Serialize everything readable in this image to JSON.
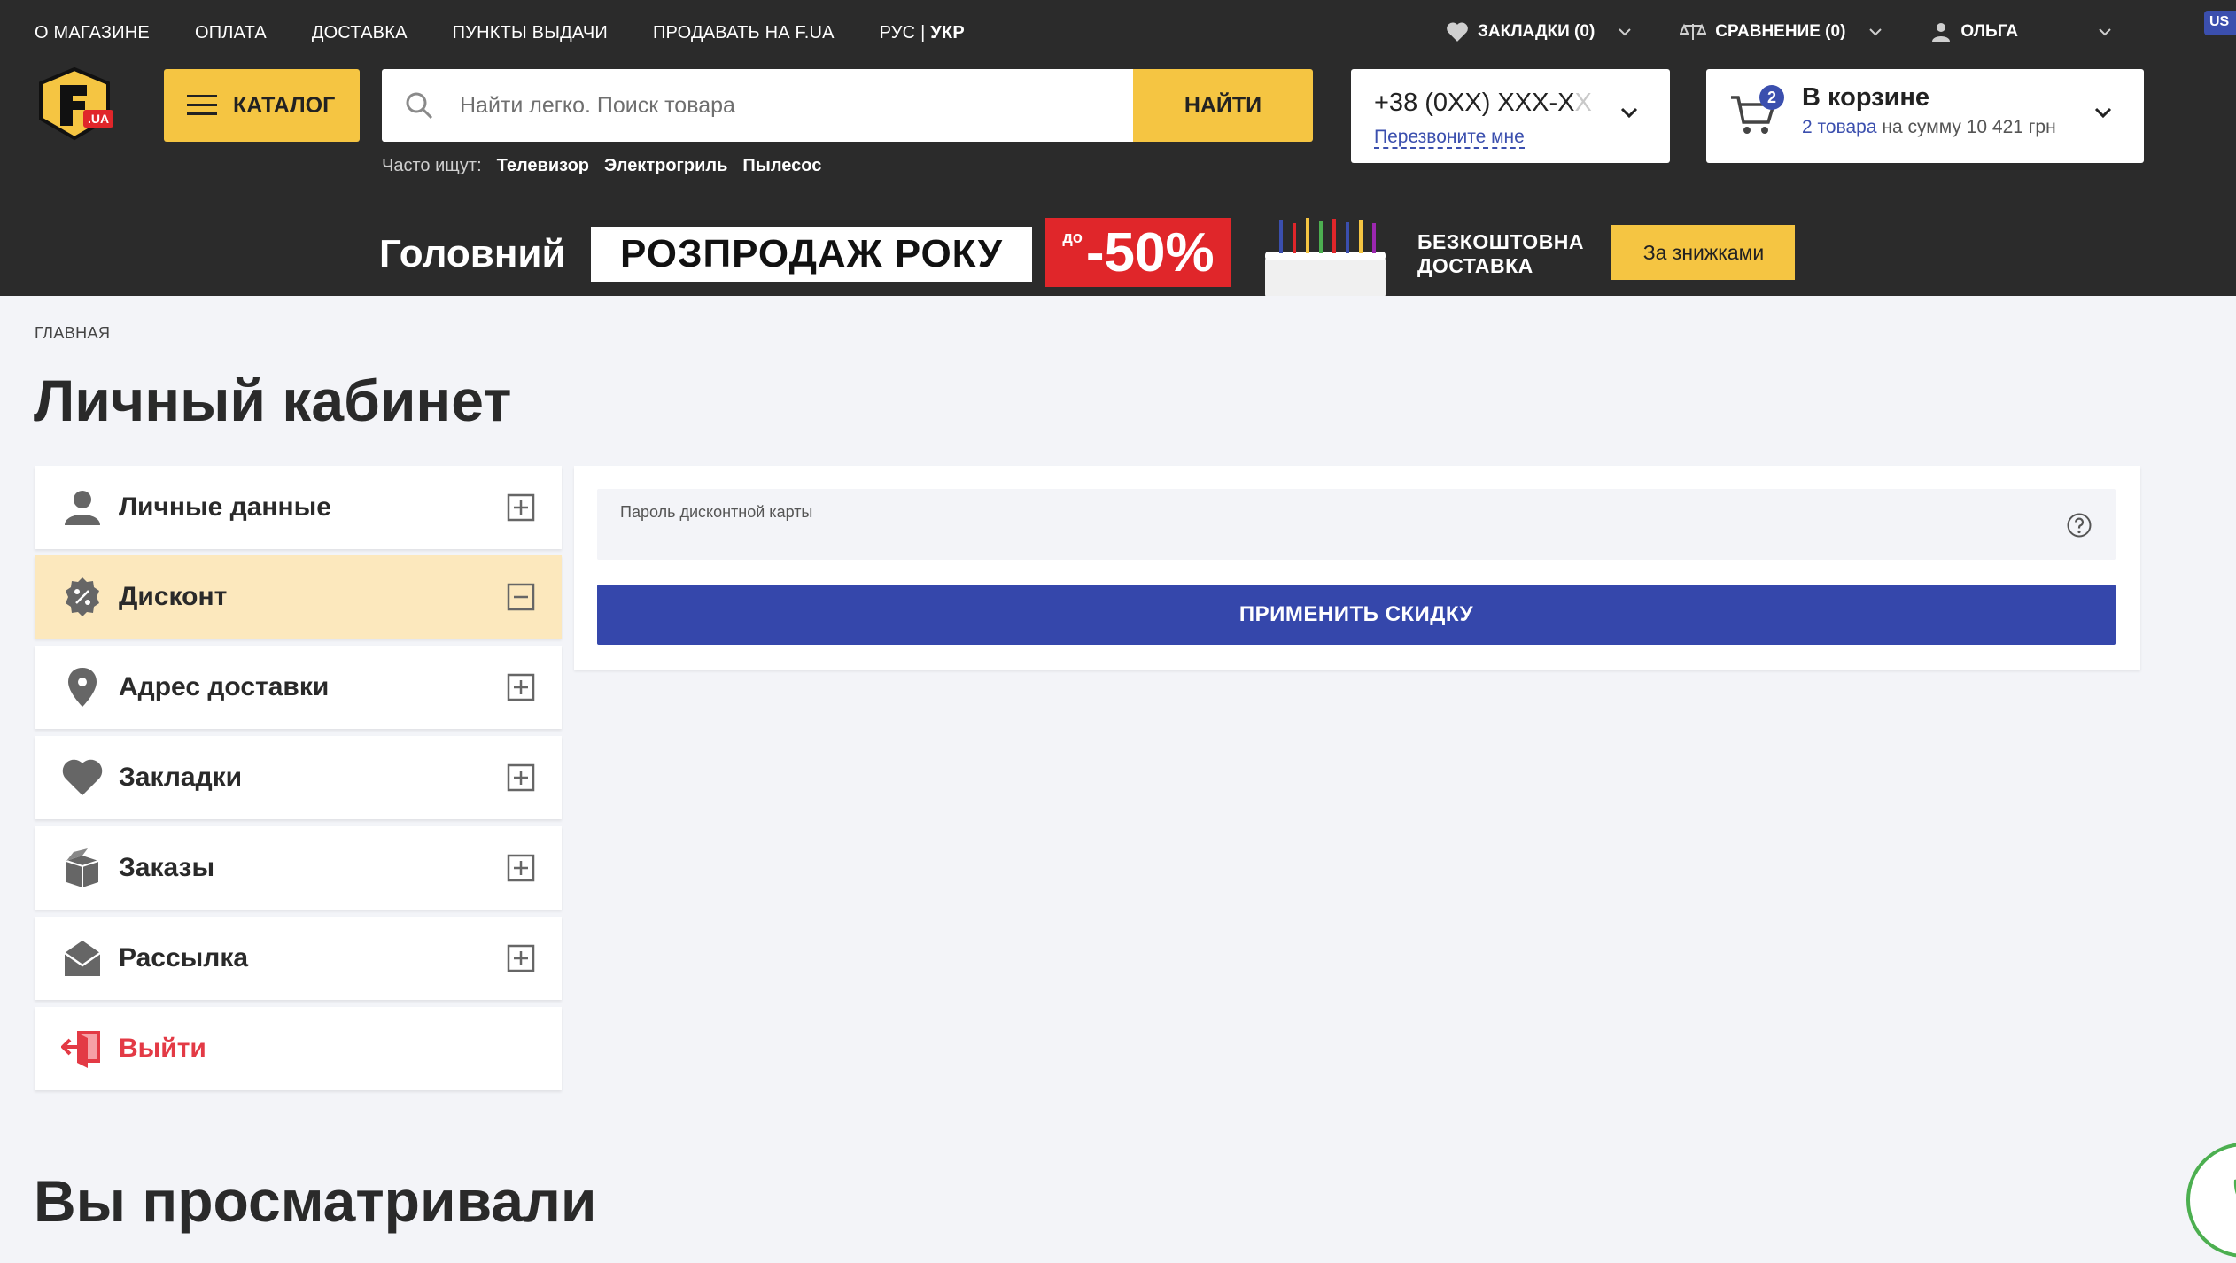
{
  "topnav": {
    "about": "О МАГАЗИНЕ",
    "payment": "ОПЛАТА",
    "delivery": "ДОСТАВКА",
    "pickup": "ПУНКТЫ ВЫДАЧИ",
    "sell": "ПРОДАВАТЬ НА F.UA",
    "lang_ru": "РУС",
    "lang_sep": "|",
    "lang_uk": "УКР"
  },
  "toplinks": {
    "bookmarks": "ЗАКЛАДКИ (0)",
    "compare": "СРАВНЕНИЕ (0)",
    "user": "ОЛЬГА",
    "usa": "US"
  },
  "header": {
    "logo_text": ".UA",
    "catalog_label": "КАТАЛОГ",
    "search_placeholder": "Найти легко. Поиск товара",
    "search_button": "НАЙТИ",
    "popular_label": "Часто ищут:",
    "popular": [
      "Телевизор",
      "Электрогриль",
      "Пылесос"
    ],
    "phone": "+38 (0XX) XXX-X",
    "phone_fade": "X",
    "callback": "Перезвоните мне",
    "cart_count": "2",
    "cart_title": "В корзине",
    "cart_items": "2 товара",
    "cart_sum": "на сумму 10 421 грн"
  },
  "banner": {
    "part1": "Головний",
    "part2": "РОЗПРОДАЖ РОКУ",
    "discount_prefix": "до",
    "discount": "-50%",
    "free_line1": "БЕЗКОШТОВНА",
    "free_line2": "ДОСТАВКА",
    "cta": "За знижками"
  },
  "breadcrumb": "ГЛАВНАЯ",
  "page_title": "Личный кабинет",
  "menu": [
    {
      "label": "Личные данные",
      "icon": "user-icon",
      "toggle": "plus"
    },
    {
      "label": "Дисконт",
      "icon": "discount-icon",
      "toggle": "minus",
      "active": true
    },
    {
      "label": "Адрес доставки",
      "icon": "location-icon",
      "toggle": "plus"
    },
    {
      "label": "Закладки",
      "icon": "heart-icon",
      "toggle": "plus"
    },
    {
      "label": "Заказы",
      "icon": "box-icon",
      "toggle": "plus"
    },
    {
      "label": "Рассылка",
      "icon": "envelope-icon",
      "toggle": "plus"
    },
    {
      "label": "Выйти",
      "icon": "logout-icon"
    }
  ],
  "discount_card": {
    "field_label": "Пароль дисконтной карты",
    "field_value": "",
    "apply_button": "ПРИМЕНИТЬ СКИДКУ"
  },
  "viewed_title": "Вы просматривали",
  "colors": {
    "header_bg": "#2b2b2b",
    "accent_yellow": "#f5c542",
    "primary_blue": "#3547ab",
    "active_item_bg": "#fce8bd",
    "logout_red": "#e33a45",
    "page_bg": "#f3f4f8"
  }
}
